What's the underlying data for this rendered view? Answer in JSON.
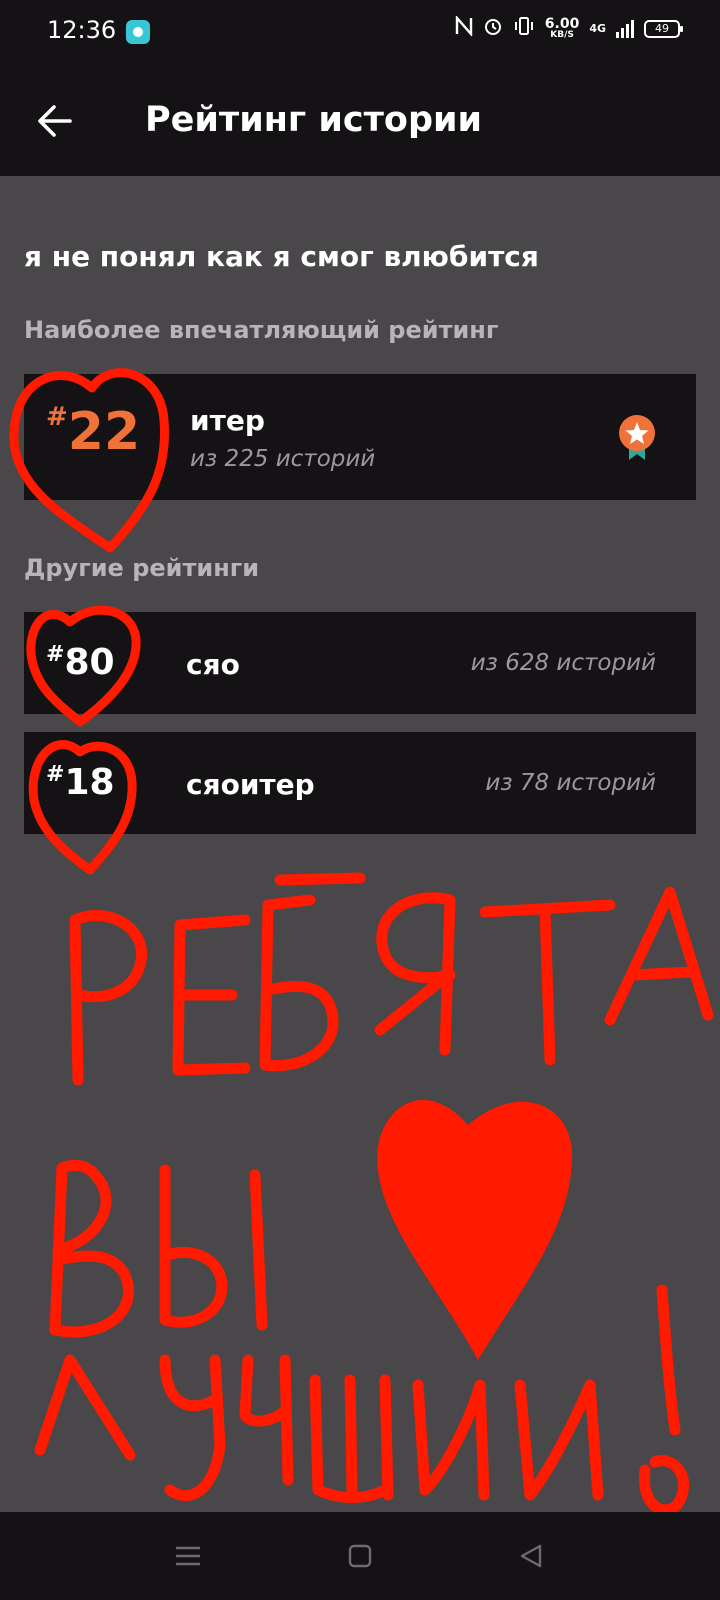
{
  "status_bar": {
    "time": "12:36",
    "speed_value": "6.00",
    "speed_unit": "KB/S",
    "network": "4G",
    "battery": "49"
  },
  "header": {
    "title": "Рейтинг истории",
    "back_icon": "arrow-left-icon"
  },
  "story": {
    "title": "я не понял как я смог влюбится"
  },
  "top_rating": {
    "section_label": "Наиболее впечатляющий рейтинг",
    "hash": "#",
    "rank": "22",
    "genre": "итер",
    "count": "из 225 историй",
    "badge_icon": "medal-star-icon",
    "rank_color": "#f07238"
  },
  "other_ratings": {
    "section_label": "Другие рейтинги",
    "items": [
      {
        "hash": "#",
        "rank": "80",
        "genre": "сяо",
        "count": "из 628 историй"
      },
      {
        "hash": "#",
        "rank": "18",
        "genre": "сяоитер",
        "count": "из 78 историй"
      }
    ]
  },
  "overlay": {
    "handwriting_line1": "РЕБЯТА",
    "handwriting_line2": "ВЫ",
    "handwriting_line3": "ЛУЧШИИ!",
    "color": "#ff1a00"
  },
  "nav_bar": {
    "menu_icon": "menu-icon",
    "home_icon": "home-square-icon",
    "back_icon": "back-triangle-icon"
  }
}
